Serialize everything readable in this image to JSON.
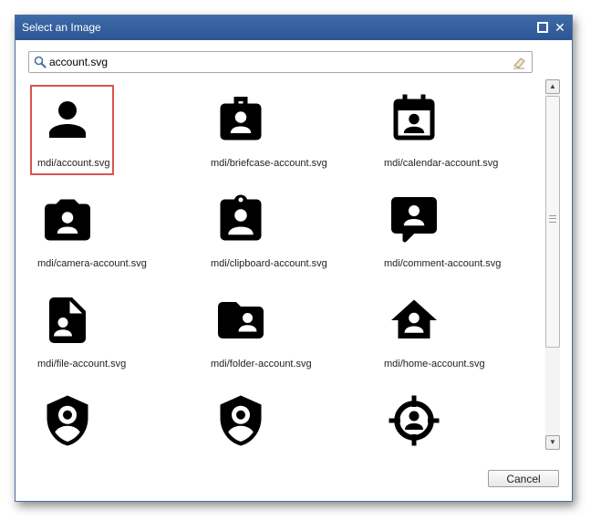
{
  "dialog": {
    "title": "Select an Image",
    "cancel_label": "Cancel"
  },
  "search": {
    "value": "account.svg",
    "icon": "search-icon",
    "clear_icon": "eraser-icon"
  },
  "colors": {
    "titlebar": "#2c5594",
    "selection": "#d9534f"
  },
  "items": [
    {
      "label": "mdi/account.svg",
      "icon": "account-icon",
      "selected": true
    },
    {
      "label": "mdi/briefcase-account.svg",
      "icon": "briefcase-account-icon"
    },
    {
      "label": "mdi/calendar-account.svg",
      "icon": "calendar-account-icon"
    },
    {
      "label": "mdi/camera-account.svg",
      "icon": "camera-account-icon"
    },
    {
      "label": "mdi/clipboard-account.svg",
      "icon": "clipboard-account-icon"
    },
    {
      "label": "mdi/comment-account.svg",
      "icon": "comment-account-icon"
    },
    {
      "label": "mdi/file-account.svg",
      "icon": "file-account-icon"
    },
    {
      "label": "mdi/folder-account.svg",
      "icon": "folder-account-icon"
    },
    {
      "label": "mdi/home-account.svg",
      "icon": "home-account-icon"
    },
    {
      "label": "",
      "icon": "shield-account-icon"
    },
    {
      "label": "",
      "icon": "shield-account-variant-icon"
    },
    {
      "label": "",
      "icon": "target-account-icon"
    }
  ]
}
